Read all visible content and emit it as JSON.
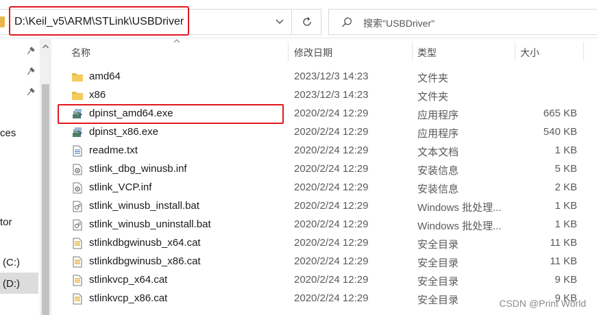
{
  "address_bar": {
    "path": "D:\\Keil_v5\\ARM\\STLink\\USBDriver"
  },
  "search": {
    "placeholder": "搜索\"USBDriver\""
  },
  "nav_pane": {
    "items": [
      {
        "label": "ces"
      },
      {
        "label": "tor"
      },
      {
        "label": "(C:)"
      },
      {
        "label": "(D:)"
      }
    ]
  },
  "columns": {
    "name": "名称",
    "date": "修改日期",
    "type": "类型",
    "size": "大小"
  },
  "files": [
    {
      "name": "amd64",
      "date": "2023/12/3 14:23",
      "type": "文件夹",
      "size": "",
      "icon": "folder-icon"
    },
    {
      "name": "x86",
      "date": "2023/12/3 14:23",
      "type": "文件夹",
      "size": "",
      "icon": "folder-icon"
    },
    {
      "name": "dpinst_amd64.exe",
      "date": "2020/2/24 12:29",
      "type": "应用程序",
      "size": "665 KB",
      "icon": "installer-exe-icon"
    },
    {
      "name": "dpinst_x86.exe",
      "date": "2020/2/24 12:29",
      "type": "应用程序",
      "size": "540 KB",
      "icon": "installer-exe-icon"
    },
    {
      "name": "readme.txt",
      "date": "2020/2/24 12:29",
      "type": "文本文档",
      "size": "1 KB",
      "icon": "text-file-icon"
    },
    {
      "name": "stlink_dbg_winusb.inf",
      "date": "2020/2/24 12:29",
      "type": "安装信息",
      "size": "5 KB",
      "icon": "inf-file-icon"
    },
    {
      "name": "stlink_VCP.inf",
      "date": "2020/2/24 12:29",
      "type": "安装信息",
      "size": "2 KB",
      "icon": "inf-file-icon"
    },
    {
      "name": "stlink_winusb_install.bat",
      "date": "2020/2/24 12:29",
      "type": "Windows 批处理...",
      "size": "1 KB",
      "icon": "batch-file-icon"
    },
    {
      "name": "stlink_winusb_uninstall.bat",
      "date": "2020/2/24 12:29",
      "type": "Windows 批处理...",
      "size": "1 KB",
      "icon": "batch-file-icon"
    },
    {
      "name": "stlinkdbgwinusb_x64.cat",
      "date": "2020/2/24 12:29",
      "type": "安全目录",
      "size": "11 KB",
      "icon": "security-catalog-icon"
    },
    {
      "name": "stlinkdbgwinusb_x86.cat",
      "date": "2020/2/24 12:29",
      "type": "安全目录",
      "size": "11 KB",
      "icon": "security-catalog-icon"
    },
    {
      "name": "stlinkvcp_x64.cat",
      "date": "2020/2/24 12:29",
      "type": "安全目录",
      "size": "9 KB",
      "icon": "security-catalog-icon"
    },
    {
      "name": "stlinkvcp_x86.cat",
      "date": "2020/2/24 12:29",
      "type": "安全目录",
      "size": "9 KB",
      "icon": "security-catalog-icon"
    }
  ],
  "watermark": "CSDN @Print World",
  "colors": {
    "highlight": "#e0181e",
    "folder": "#f0c24f",
    "selected_nav": "#dcdcdc"
  }
}
